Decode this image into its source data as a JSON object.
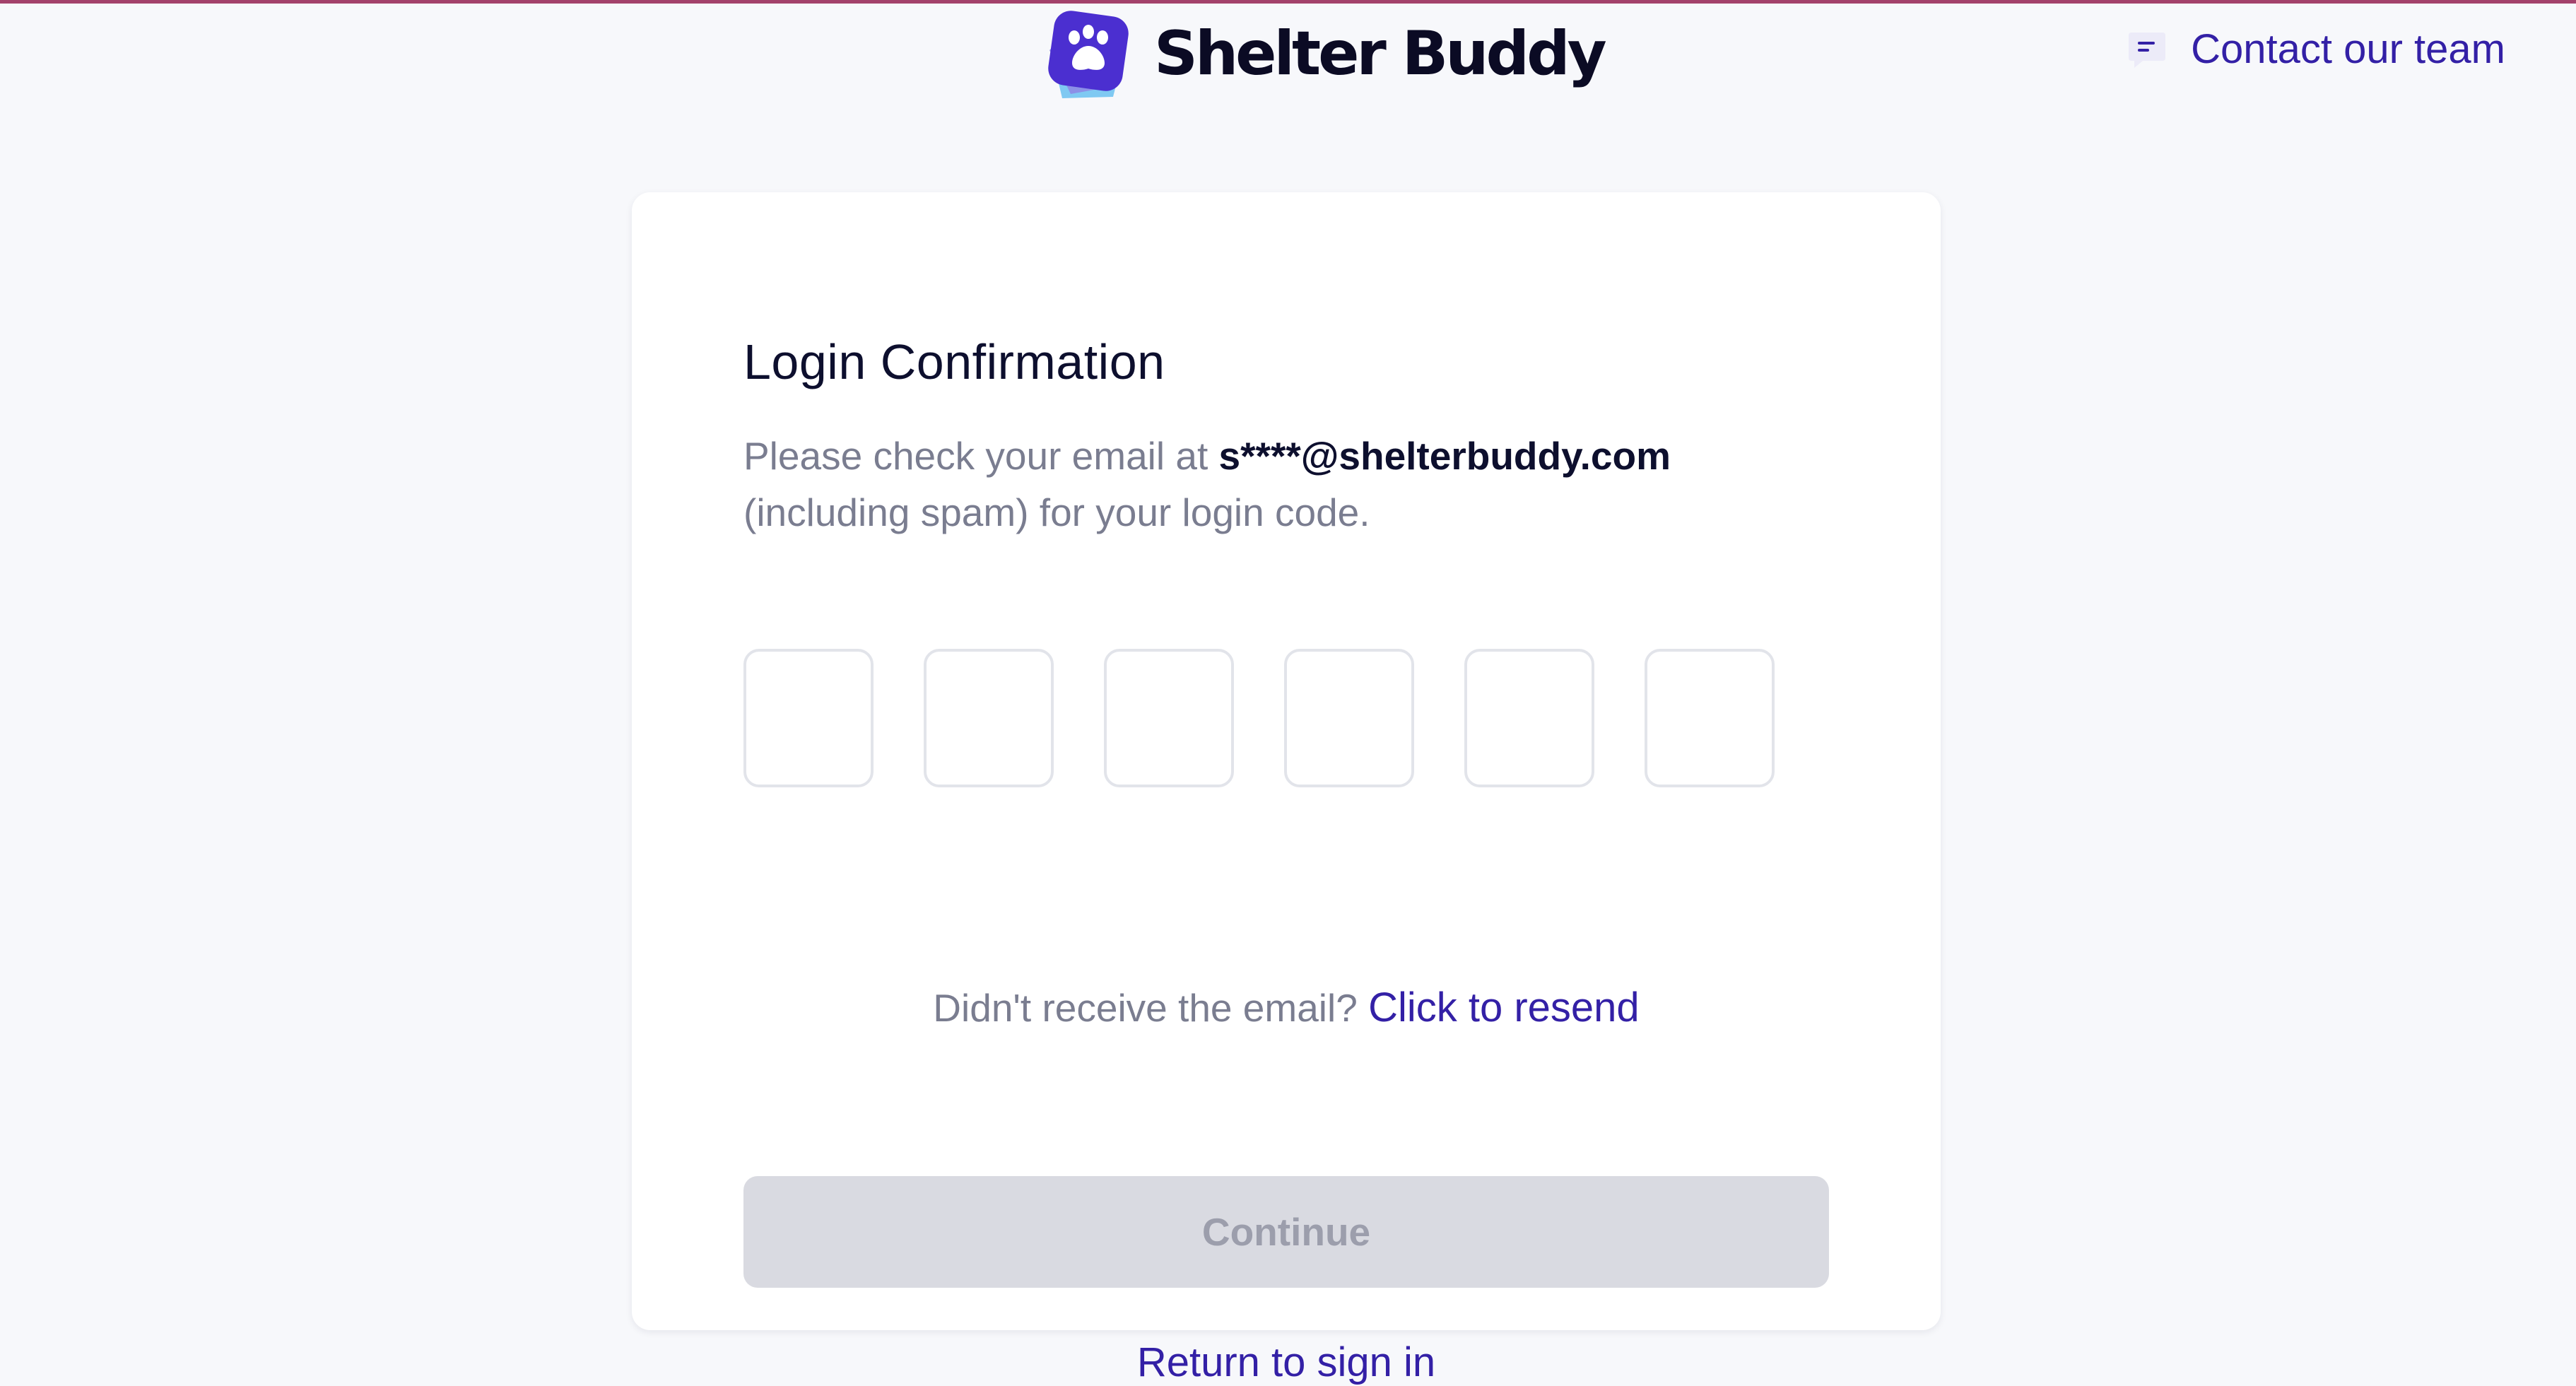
{
  "header": {
    "brand_name": "Shelter Buddy",
    "contact_label": "Contact our team",
    "logo_icon": "paw-icon",
    "contact_icon": "chat-icon"
  },
  "login": {
    "title": "Login Confirmation",
    "description_prefix": "Please check your email at ",
    "email": "s****@shelterbuddy.com",
    "description_suffix": "(including spam) for your login code.",
    "code_digits": [
      "",
      "",
      "",
      "",
      "",
      ""
    ],
    "resend_prompt": "Didn't receive the email?",
    "resend_link": "Click to resend",
    "continue_label": "Continue",
    "return_label": "Return to sign in"
  },
  "colors": {
    "accent": "#3320a6",
    "brand_purple": "#4b2fd0",
    "top_border": "#a3426b",
    "disabled_button": "#d9dae1",
    "page_background": "#f7f8fb"
  }
}
